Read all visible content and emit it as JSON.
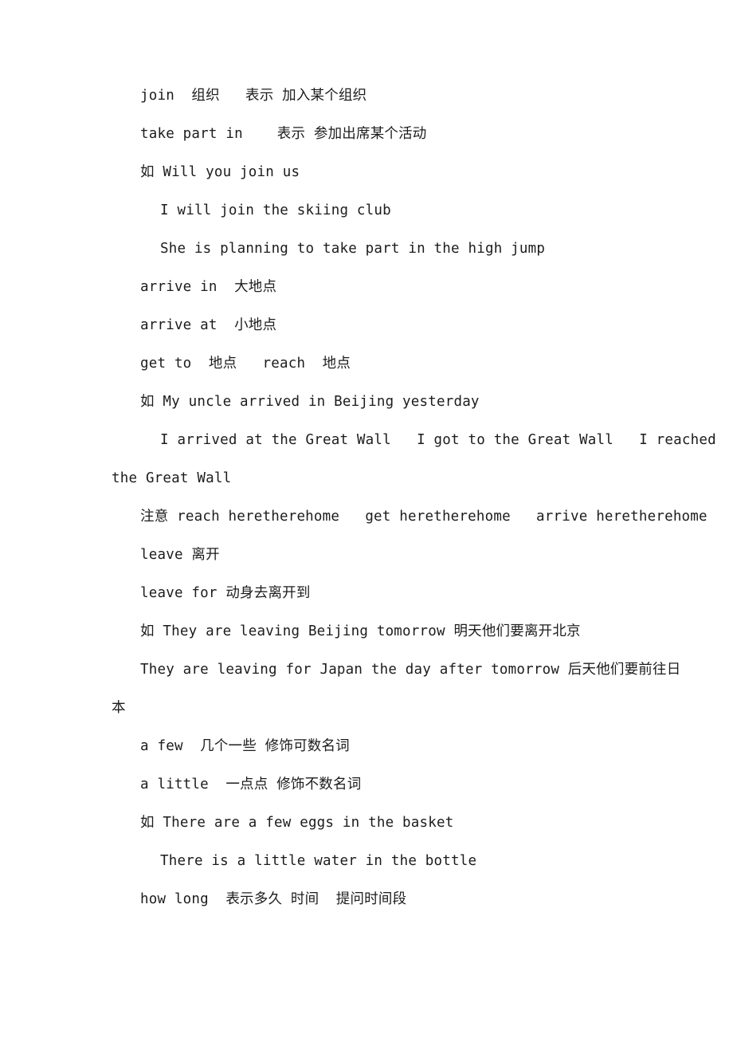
{
  "document": {
    "page_background": "#ffffff",
    "text_color": "#1c1c1c",
    "lines": [
      {
        "id": "l01",
        "indent": 1,
        "text": "join  组织   表示 加入某个组织"
      },
      {
        "id": "l02",
        "indent": 1,
        "text": "take part in    表示 参加出席某个活动"
      },
      {
        "id": "l03",
        "indent": 1,
        "text": "如 Will you join us"
      },
      {
        "id": "l04",
        "indent": 2,
        "text": "I will join the skiing club"
      },
      {
        "id": "l05",
        "indent": 2,
        "text": "She is planning to take part in the high jump"
      },
      {
        "id": "l06",
        "indent": 1,
        "text": "arrive in  大地点"
      },
      {
        "id": "l07",
        "indent": 1,
        "text": "arrive at  小地点"
      },
      {
        "id": "l08",
        "indent": 1,
        "text": "get to  地点   reach  地点"
      },
      {
        "id": "l09",
        "indent": 1,
        "text": "如 My uncle arrived in Beijing yesterday"
      },
      {
        "id": "l10",
        "indent": 2,
        "text": "I arrived at the Great Wall   I got to the Great Wall   I reached"
      },
      {
        "id": "l11",
        "indent": 0,
        "text": "the Great Wall"
      },
      {
        "id": "l12",
        "indent": 1,
        "text": "注意 reach heretherehome   get heretherehome   arrive heretherehome"
      },
      {
        "id": "l13",
        "indent": 1,
        "text": "leave 离开"
      },
      {
        "id": "l14",
        "indent": 1,
        "text": "leave for 动身去离开到"
      },
      {
        "id": "l15",
        "indent": 1,
        "text": "如 They are leaving Beijing tomorrow 明天他们要离开北京"
      },
      {
        "id": "l16",
        "indent": 1,
        "text": "They are leaving for Japan the day after tomorrow 后天他们要前往日"
      },
      {
        "id": "l17",
        "indent": 0,
        "text": "本"
      },
      {
        "id": "l18",
        "indent": 1,
        "text": "a few  几个一些 修饰可数名词"
      },
      {
        "id": "l19",
        "indent": 1,
        "text": "a little  一点点 修饰不数名词"
      },
      {
        "id": "l20",
        "indent": 1,
        "text": "如 There are a few eggs in the basket"
      },
      {
        "id": "l21",
        "indent": 2,
        "text": "There is a little water in the bottle"
      },
      {
        "id": "l22",
        "indent": 1,
        "text": "how long  表示多久 时间  提问时间段"
      }
    ]
  }
}
